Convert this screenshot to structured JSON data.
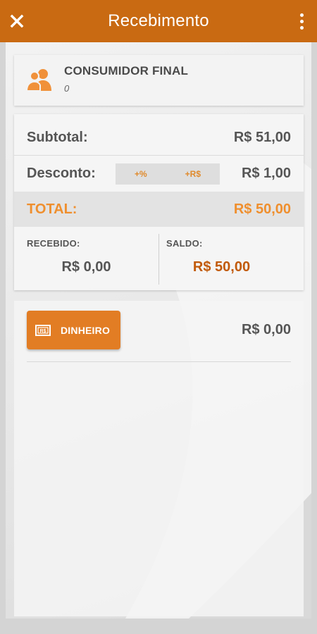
{
  "header": {
    "title": "Recebimento",
    "close_icon": "close-icon",
    "menu_icon": "more-vertical-icon",
    "background": "#c96a12"
  },
  "customer": {
    "icon": "users-icon",
    "name": "CONSUMIDOR FINAL",
    "code": "0"
  },
  "totals": {
    "subtotal_label": "Subtotal:",
    "subtotal_value": "R$ 51,00",
    "discount_label": "Desconto:",
    "discount_percent_button": "+%",
    "discount_money_button": "+R$",
    "discount_value": "R$ 1,00",
    "total_label": "TOTAL:",
    "total_value": "R$ 50,00",
    "accent": "#ef8f2e"
  },
  "balance": {
    "received_label": "RECEBIDO:",
    "received_value": "R$ 0,00",
    "balance_label": "SALDO:",
    "balance_value": "R$ 50,00"
  },
  "payments": [
    {
      "method_label": "DINHEIRO",
      "icon": "cash-icon",
      "amount": "R$ 0,00"
    }
  ]
}
